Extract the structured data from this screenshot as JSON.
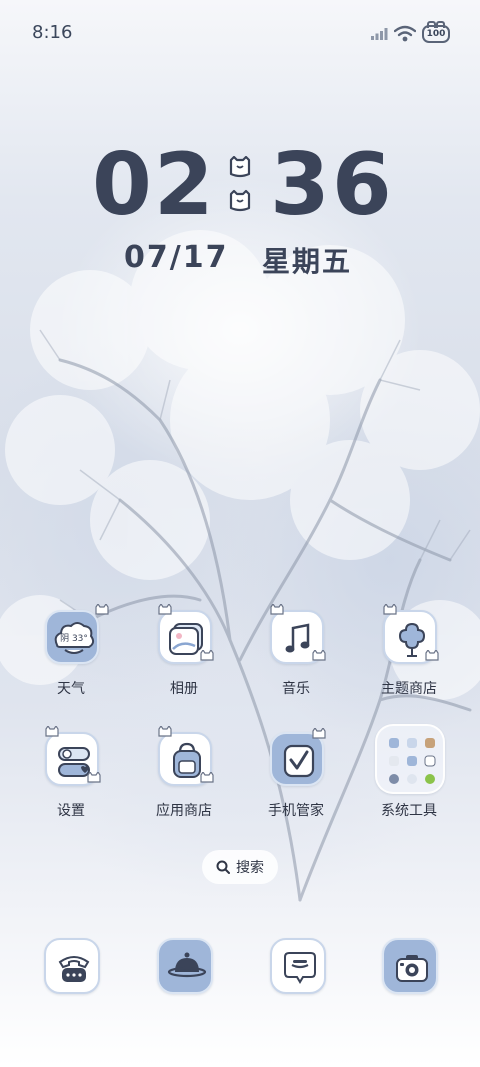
{
  "status_bar": {
    "time": "8:16",
    "battery": "100",
    "icons": [
      "signal-icon",
      "wifi-icon",
      "battery-icon"
    ]
  },
  "clock": {
    "hours": "02",
    "minutes": "36",
    "date": "07/17",
    "weekday": "星期五"
  },
  "apps": [
    {
      "label": "天气",
      "icon": "weather-cloud-icon",
      "badge": "阴 33°"
    },
    {
      "label": "相册",
      "icon": "gallery-icon"
    },
    {
      "label": "音乐",
      "icon": "music-note-icon"
    },
    {
      "label": "主题商店",
      "icon": "theme-flower-icon"
    },
    {
      "label": "设置",
      "icon": "settings-toggle-icon"
    },
    {
      "label": "应用商店",
      "icon": "app-store-bag-icon"
    },
    {
      "label": "手机管家",
      "icon": "phone-manager-check-icon"
    },
    {
      "label": "系统工具",
      "icon": "system-tools-folder-icon"
    }
  ],
  "search": {
    "label": "搜索",
    "icon": "search-icon"
  },
  "dock": [
    {
      "icon": "phone-dial-icon"
    },
    {
      "icon": "browser-planet-icon"
    },
    {
      "icon": "messages-bubble-icon"
    },
    {
      "icon": "camera-icon"
    }
  ],
  "colors": {
    "text_dark": "#3b4459",
    "icon_blue": "#9fb6d9",
    "icon_border": "#c9d6ea"
  }
}
